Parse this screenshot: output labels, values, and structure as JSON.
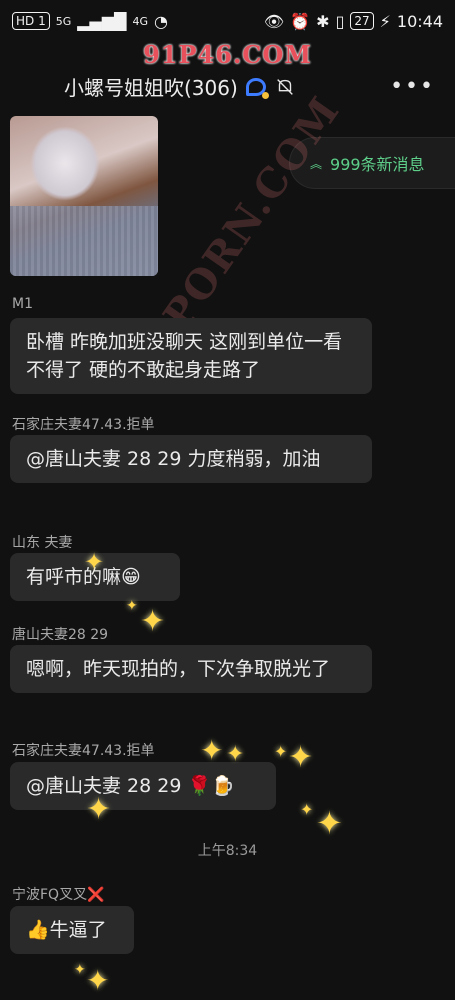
{
  "status_bar": {
    "left_badges": [
      "HD 1",
      "5G",
      "4G"
    ],
    "battery": "27",
    "time": "10:44"
  },
  "watermark_top": "91P46.COM",
  "watermark_diagonal": "91PORN.COM",
  "header": {
    "title": "小螺号姐姐吹(306)"
  },
  "new_messages": "999条新消息",
  "messages": [
    {
      "sender": "M1",
      "text": "卧槽  昨晚加班没聊天  这刚到单位一看不得了  硬的不敢起身走路了"
    },
    {
      "sender": "石家庄夫妻47.43.拒单",
      "text": "@唐山夫妻 28  29  力度稍弱，加油"
    },
    {
      "sender": "山东 夫妻",
      "text": "有呼市的嘛😁"
    },
    {
      "sender": "唐山夫妻28  29",
      "text": "嗯啊，昨天现拍的，下次争取脱光了"
    },
    {
      "sender": "石家庄夫妻47.43.拒单",
      "text": "@唐山夫妻 28  29 🌹🍺"
    },
    {
      "sender": "宁波FQ叉叉❌",
      "text": "👍牛逼了"
    }
  ],
  "time_divider": "上午8:34",
  "colors": {
    "background": "#111111",
    "bubble": "#2a2a2a",
    "accent_green": "#5ecf8a",
    "watermark_red": "#e8505b"
  }
}
